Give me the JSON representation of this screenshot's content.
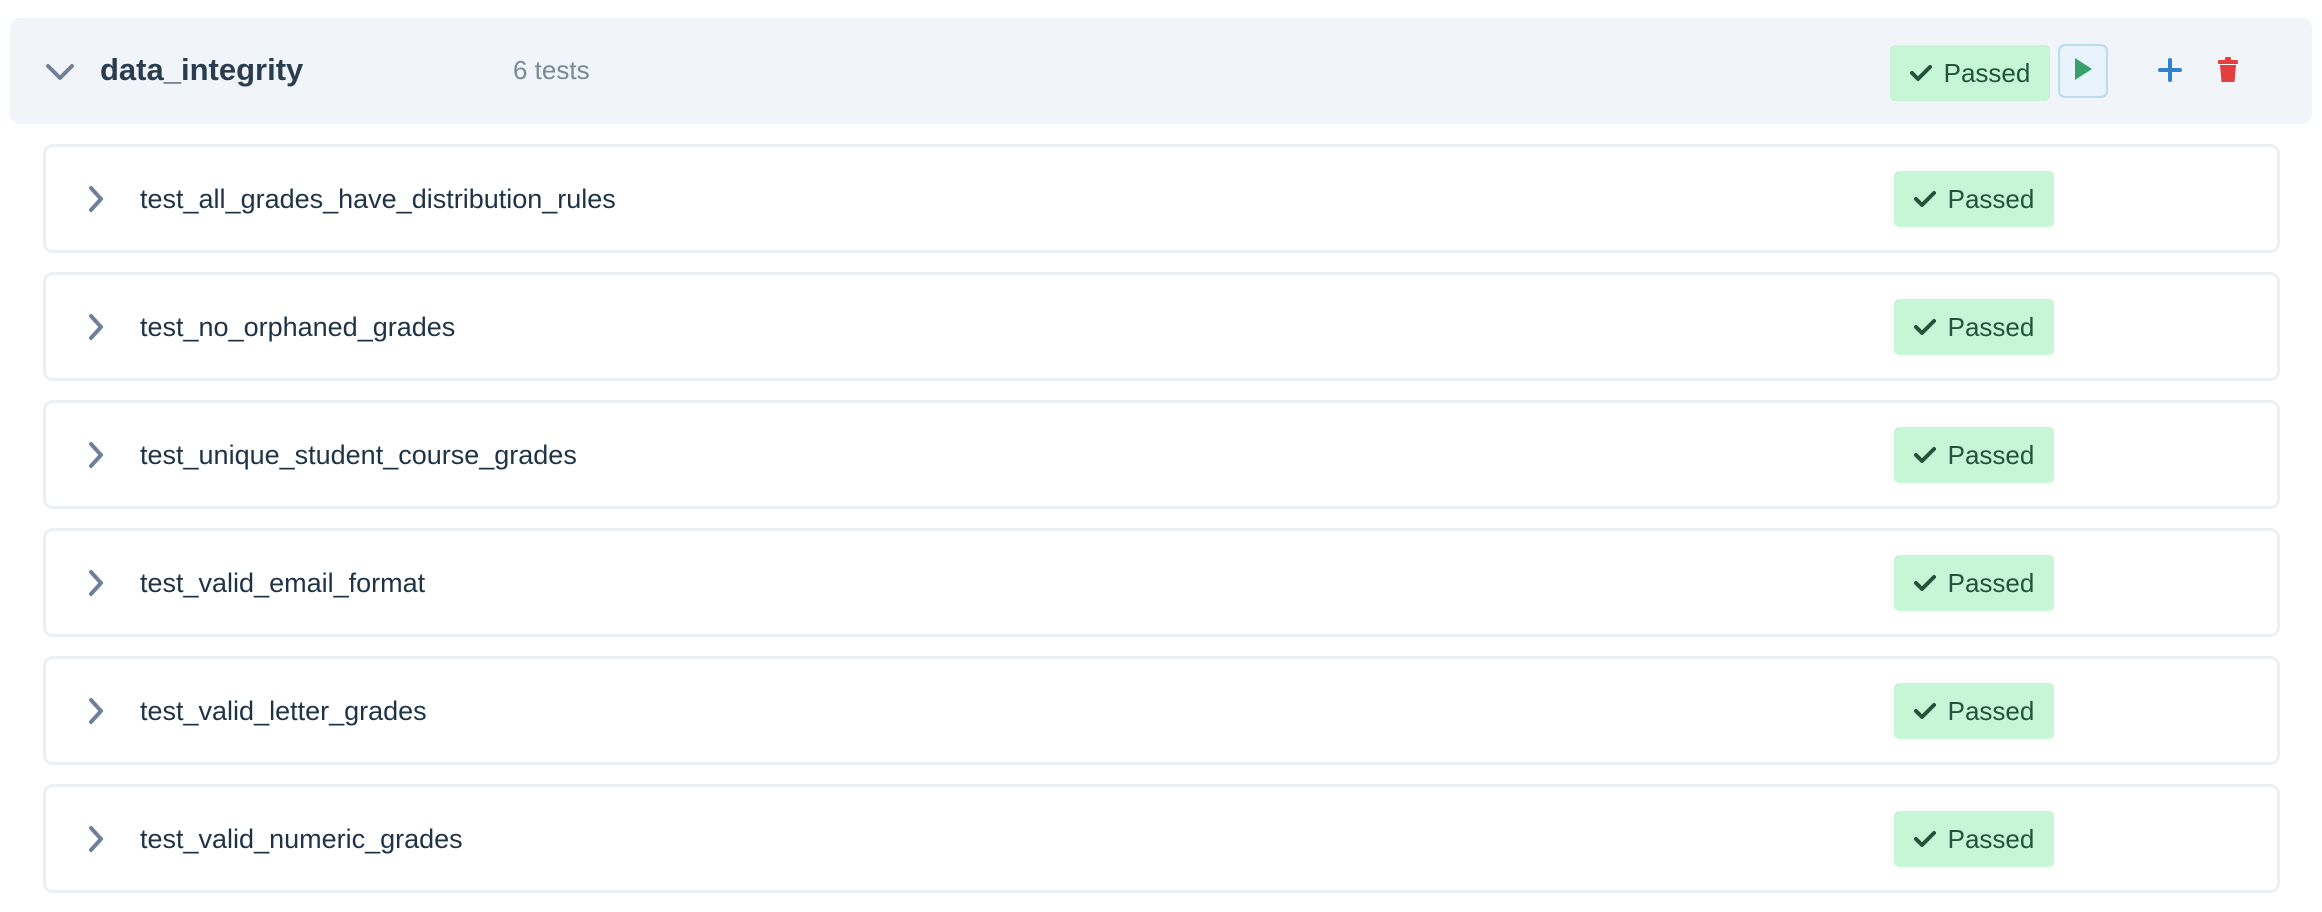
{
  "suite": {
    "name": "data_integrity",
    "count_label": "6 tests",
    "status_label": "Passed",
    "icons": {
      "collapse": "chevron-down-icon",
      "status": "check-icon",
      "run": "play-icon",
      "add": "plus-icon",
      "delete": "trash-icon"
    },
    "colors": {
      "header_bg": "#f1f4f8",
      "passed_bg": "#c6f6d5",
      "passed_text": "#22543d",
      "run_icon": "#38a169",
      "add_icon": "#3182ce",
      "delete_icon": "#e53e3e",
      "chevron": "#718096"
    }
  },
  "tests": [
    {
      "name": "test_all_grades_have_distribution_rules",
      "status_label": "Passed"
    },
    {
      "name": "test_no_orphaned_grades",
      "status_label": "Passed"
    },
    {
      "name": "test_unique_student_course_grades",
      "status_label": "Passed"
    },
    {
      "name": "test_valid_email_format",
      "status_label": "Passed"
    },
    {
      "name": "test_valid_letter_grades",
      "status_label": "Passed"
    },
    {
      "name": "test_valid_numeric_grades",
      "status_label": "Passed"
    }
  ]
}
